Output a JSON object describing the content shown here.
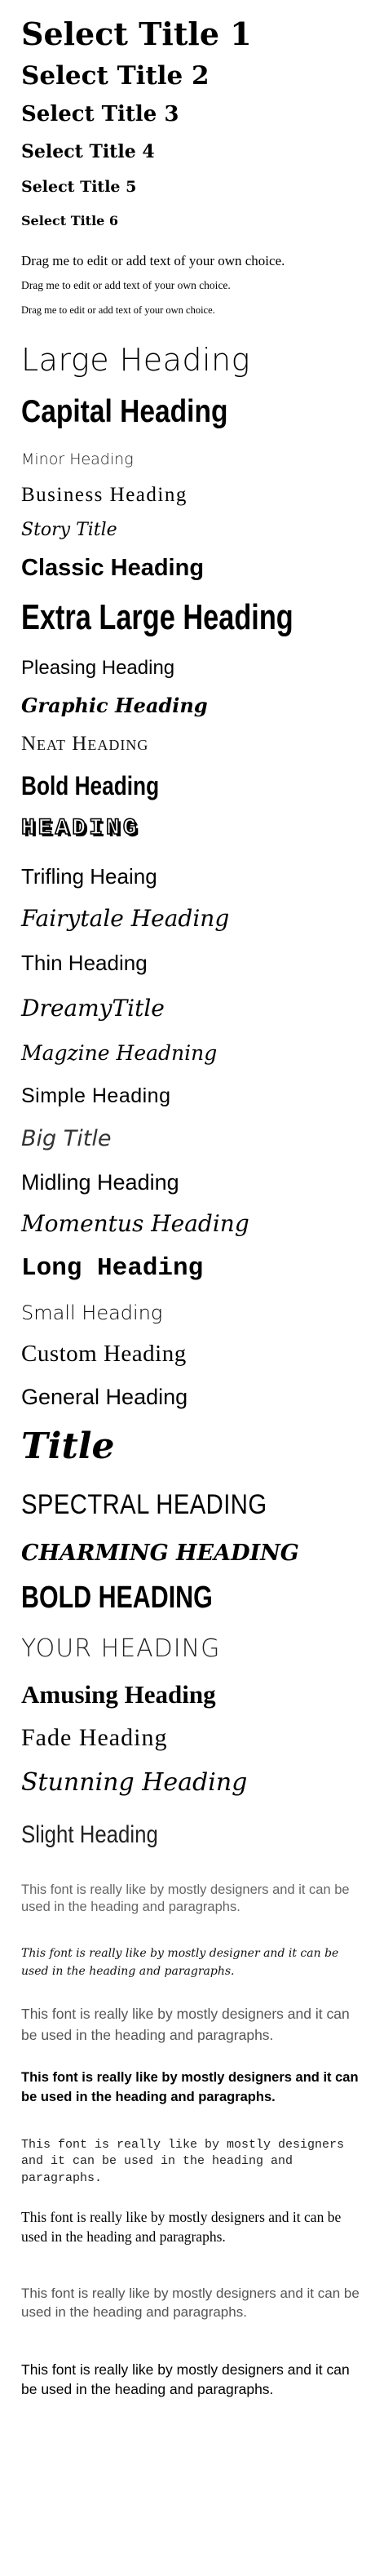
{
  "select_titles": [
    "Select Title 1",
    "Select Title 2",
    "Select Title 3",
    "Select Title 4",
    "Select Title 5",
    "Select Title 6"
  ],
  "drag_texts": [
    "Drag me to edit or add text of your own choice.",
    "Drag me to edit or add text of your own choice.",
    "Drag me to edit or add text of your own choice."
  ],
  "headings": [
    "Large Heading",
    "Capital Heading",
    "Minor Heading",
    "Business Heading",
    "Story Title",
    "Classic Heading",
    "Extra Large Heading",
    "Pleasing Heading",
    "Graphic Heading",
    "Neat Heading",
    "Bold Heading",
    "HEADING",
    "Trifling Heaing",
    "Fairytale Heading",
    "Thin Heading",
    "DreamyTitle",
    "Magzine Headning",
    "Simple Heading",
    "Big Title",
    "Midling Heading",
    "Momentus Heading",
    "Long Heading",
    "Small Heading",
    "Custom Heading",
    "General Heading",
    "Title",
    "SPECTRAL HEADING",
    "CHARMING HEADING",
    "BOLD HEADING",
    "YOUR HEADING",
    "Amusing Heading",
    "Fade Heading",
    "Stunning Heading",
    "Slight Heading"
  ],
  "paragraphs": [
    "This font is really like by mostly designers and it can be used in the heading and paragraphs.",
    "This font is really like by mostly designer and it can be used in the heading and paragraphs.",
    "This font is really like by mostly designers and it can be used in the heading and paragraphs.",
    "This font is really like by mostly designers and it can be used in the heading and paragraphs.",
    "This font is really like by mostly designers and it can be used in the heading and paragraphs.",
    "This font is really like by mostly designers and it can be used in the heading and paragraphs.",
    "This font is really like by mostly designers and it can be used in the heading and paragraphs.",
    "This font is really like by mostly designers and it can be used in the heading and paragraphs."
  ]
}
